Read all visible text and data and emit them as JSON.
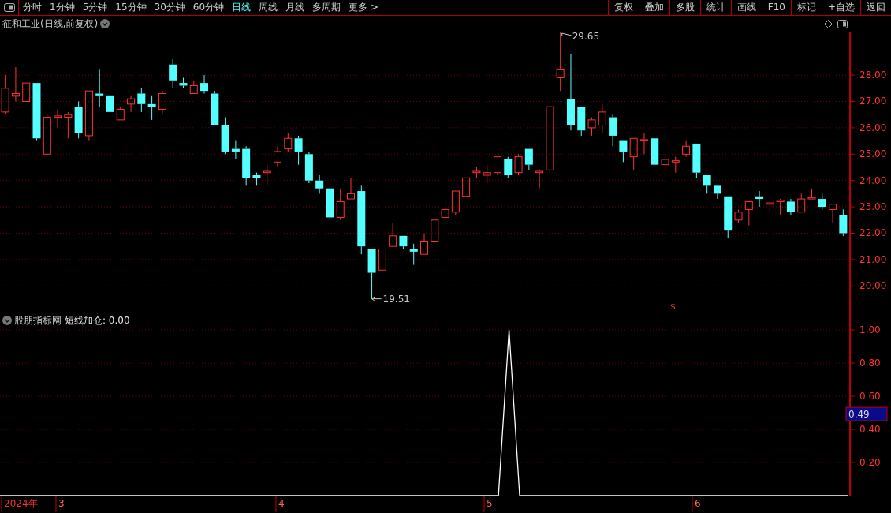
{
  "toolbar": {
    "periods": [
      {
        "label": "分时",
        "selected": false
      },
      {
        "label": "1分钟",
        "selected": false
      },
      {
        "label": "5分钟",
        "selected": false
      },
      {
        "label": "15分钟",
        "selected": false
      },
      {
        "label": "30分钟",
        "selected": false
      },
      {
        "label": "60分钟",
        "selected": false
      },
      {
        "label": "日线",
        "selected": true
      },
      {
        "label": "周线",
        "selected": false
      },
      {
        "label": "月线",
        "selected": false
      },
      {
        "label": "多周期",
        "selected": false
      },
      {
        "label": "更多 >",
        "selected": false
      }
    ],
    "buttons": [
      "复权",
      "叠加",
      "多股",
      "统计",
      "画线",
      "F10",
      "标记",
      "+自选",
      "返回"
    ]
  },
  "price_panel": {
    "title": "征和工业(日线,前复权)",
    "high_label": "29.65",
    "low_label": "19.51",
    "event_mark": "$",
    "chart_data": {
      "type": "candlestick",
      "grid": true,
      "ylim": [
        18.99,
        29.65
      ],
      "yticks": [
        {
          "value": 28,
          "label": "28.00"
        },
        {
          "value": 27,
          "label": "27.00"
        },
        {
          "value": 26,
          "label": "26.00"
        },
        {
          "value": 25,
          "label": "25.00"
        },
        {
          "value": 24,
          "label": "24.00"
        },
        {
          "value": 23,
          "label": "23.00"
        },
        {
          "value": 22,
          "label": "22.00"
        },
        {
          "value": 21,
          "label": "21.00"
        },
        {
          "value": 20,
          "label": "20.00"
        }
      ],
      "ohlc": [
        [
          26.6,
          28.0,
          26.5,
          27.5
        ],
        [
          27.2,
          28.3,
          27.0,
          27.3
        ],
        [
          27.0,
          27.7,
          27.0,
          27.7
        ],
        [
          27.7,
          27.7,
          25.5,
          25.6
        ],
        [
          25.0,
          26.5,
          25.0,
          26.4
        ],
        [
          26.4,
          26.7,
          26.0,
          26.45
        ],
        [
          26.4,
          26.6,
          25.6,
          26.5
        ],
        [
          26.8,
          27.0,
          25.6,
          25.8
        ],
        [
          25.7,
          27.4,
          25.5,
          27.4
        ],
        [
          27.3,
          28.2,
          26.8,
          27.2
        ],
        [
          27.2,
          27.3,
          26.4,
          26.6
        ],
        [
          26.3,
          26.8,
          26.3,
          26.7
        ],
        [
          26.9,
          27.2,
          26.6,
          27.1
        ],
        [
          27.3,
          27.5,
          26.6,
          26.9
        ],
        [
          26.9,
          27.2,
          26.3,
          26.8
        ],
        [
          26.7,
          27.4,
          26.5,
          27.3
        ],
        [
          28.4,
          28.6,
          27.5,
          27.8
        ],
        [
          27.7,
          27.9,
          27.5,
          27.6
        ],
        [
          27.3,
          27.8,
          27.3,
          27.6
        ],
        [
          27.7,
          28.0,
          27.3,
          27.4
        ],
        [
          27.3,
          27.4,
          26.1,
          26.1
        ],
        [
          26.1,
          26.4,
          25.0,
          25.1
        ],
        [
          25.2,
          25.5,
          24.8,
          25.1
        ],
        [
          25.2,
          25.3,
          23.8,
          24.1
        ],
        [
          24.2,
          24.3,
          23.8,
          24.1
        ],
        [
          24.3,
          24.6,
          23.8,
          24.35
        ],
        [
          24.7,
          25.3,
          24.5,
          25.1
        ],
        [
          25.2,
          25.8,
          25.1,
          25.6
        ],
        [
          25.6,
          25.7,
          24.6,
          25.1
        ],
        [
          25.0,
          25.1,
          23.9,
          24.0
        ],
        [
          24.0,
          24.2,
          23.5,
          23.7
        ],
        [
          23.7,
          23.7,
          22.5,
          22.6
        ],
        [
          22.6,
          23.7,
          22.5,
          23.2
        ],
        [
          23.3,
          24.1,
          23.3,
          23.5
        ],
        [
          23.6,
          23.8,
          21.2,
          21.5
        ],
        [
          21.4,
          21.4,
          19.51,
          20.5
        ],
        [
          20.6,
          21.4,
          20.6,
          21.4
        ],
        [
          21.5,
          22.4,
          21.5,
          21.9
        ],
        [
          21.9,
          21.9,
          21.4,
          21.5
        ],
        [
          21.4,
          21.6,
          20.8,
          21.3
        ],
        [
          21.2,
          22.0,
          21.2,
          21.7
        ],
        [
          21.7,
          22.5,
          21.7,
          22.5
        ],
        [
          22.6,
          23.3,
          22.5,
          22.9
        ],
        [
          22.8,
          23.6,
          22.7,
          23.6
        ],
        [
          23.4,
          24.1,
          23.4,
          24.1
        ],
        [
          24.3,
          24.5,
          24.1,
          24.35
        ],
        [
          24.2,
          24.6,
          23.9,
          24.3
        ],
        [
          24.3,
          24.9,
          24.2,
          24.9
        ],
        [
          24.8,
          24.9,
          24.1,
          24.2
        ],
        [
          24.3,
          25.0,
          24.2,
          24.9
        ],
        [
          25.2,
          25.2,
          24.4,
          24.6
        ],
        [
          24.3,
          24.4,
          23.7,
          24.35
        ],
        [
          24.4,
          26.8,
          24.3,
          26.8
        ],
        [
          27.9,
          29.65,
          27.4,
          28.2
        ],
        [
          27.1,
          28.8,
          25.9,
          26.1
        ],
        [
          26.8,
          26.8,
          25.7,
          25.9
        ],
        [
          26.0,
          26.4,
          25.7,
          26.3
        ],
        [
          26.1,
          26.9,
          25.8,
          26.6
        ],
        [
          26.4,
          26.5,
          25.3,
          25.7
        ],
        [
          25.5,
          25.5,
          24.7,
          25.1
        ],
        [
          24.9,
          25.6,
          24.4,
          25.6
        ],
        [
          25.5,
          25.8,
          25.0,
          25.55
        ],
        [
          25.6,
          25.6,
          24.6,
          24.6
        ],
        [
          24.6,
          24.8,
          24.2,
          24.8
        ],
        [
          24.7,
          24.9,
          24.3,
          24.75
        ],
        [
          25.0,
          25.5,
          24.9,
          25.3
        ],
        [
          25.4,
          25.4,
          24.1,
          24.3
        ],
        [
          24.2,
          24.2,
          23.5,
          23.8
        ],
        [
          23.8,
          23.8,
          23.3,
          23.5
        ],
        [
          23.4,
          23.4,
          21.8,
          22.1
        ],
        [
          22.5,
          22.9,
          22.4,
          22.8
        ],
        [
          22.9,
          23.2,
          22.3,
          23.2
        ],
        [
          23.4,
          23.6,
          23.0,
          23.3
        ],
        [
          23.1,
          23.2,
          22.8,
          23.15
        ],
        [
          23.2,
          23.3,
          22.7,
          23.25
        ],
        [
          23.2,
          23.3,
          22.7,
          22.8
        ],
        [
          22.8,
          23.5,
          22.8,
          23.3
        ],
        [
          23.3,
          23.7,
          23.3,
          23.35
        ],
        [
          23.3,
          23.5,
          22.9,
          23.0
        ],
        [
          22.9,
          23.1,
          22.4,
          23.1
        ],
        [
          22.7,
          22.9,
          21.9,
          22.0
        ]
      ]
    }
  },
  "indicator_panel": {
    "name": "股朋指标网",
    "readout": ": 0.00",
    "cursor_value": "0.49",
    "chart_data": {
      "type": "line",
      "grid": true,
      "series": [
        {
          "name": "短线加仓",
          "color": "#ffffff",
          "values": [
            0,
            0,
            0,
            0,
            0,
            0,
            0,
            0,
            0,
            0,
            0,
            0,
            0,
            0,
            0,
            0,
            0,
            0,
            0,
            0,
            0,
            0,
            0,
            0,
            0,
            0,
            0,
            0,
            0,
            0,
            0,
            0,
            0,
            0,
            0,
            0,
            0,
            0,
            0,
            0,
            0,
            0,
            0,
            0,
            0,
            0,
            0,
            0,
            1,
            0,
            0,
            0,
            0,
            0,
            0,
            0,
            0,
            0,
            0,
            0,
            0,
            0,
            0,
            0,
            0,
            0,
            0,
            0,
            0,
            0,
            0,
            0,
            0,
            0,
            0,
            0,
            0,
            0,
            0,
            0,
            0
          ]
        }
      ],
      "ylim": [
        0,
        1.1
      ],
      "yticks": [
        {
          "value": 0.2,
          "label": "0.20"
        },
        {
          "value": 0.4,
          "label": "0.40"
        },
        {
          "value": 0.6,
          "label": "0.60"
        },
        {
          "value": 0.8,
          "label": "0.80"
        },
        {
          "value": 1.0,
          "label": "1.00"
        }
      ]
    }
  },
  "date_axis": [
    {
      "kind": "year",
      "label": "2024年"
    },
    {
      "kind": "month",
      "label": "3"
    },
    {
      "kind": "month",
      "label": "4"
    },
    {
      "kind": "month",
      "label": "5"
    },
    {
      "kind": "month",
      "label": "6"
    }
  ]
}
